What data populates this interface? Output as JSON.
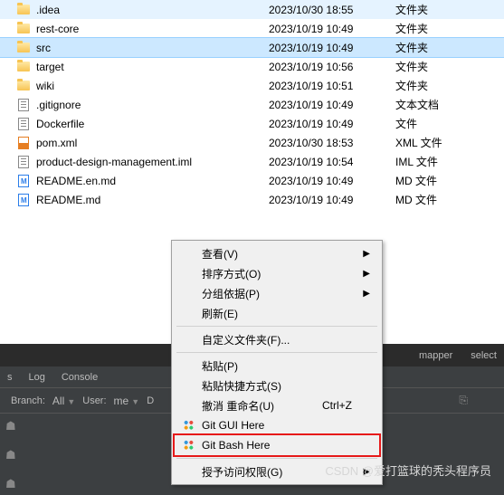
{
  "files": [
    {
      "name": ".idea",
      "date": "2023/10/30 18:55",
      "type": "文件夹",
      "icon": "folder"
    },
    {
      "name": "rest-core",
      "date": "2023/10/19 10:49",
      "type": "文件夹",
      "icon": "folder"
    },
    {
      "name": "src",
      "date": "2023/10/19 10:49",
      "type": "文件夹",
      "icon": "folder",
      "selected": true
    },
    {
      "name": "target",
      "date": "2023/10/19 10:56",
      "type": "文件夹",
      "icon": "folder"
    },
    {
      "name": "wiki",
      "date": "2023/10/19 10:51",
      "type": "文件夹",
      "icon": "folder"
    },
    {
      "name": ".gitignore",
      "date": "2023/10/19 10:49",
      "type": "文本文档",
      "icon": "doc"
    },
    {
      "name": "Dockerfile",
      "date": "2023/10/19 10:49",
      "type": "文件",
      "icon": "doc"
    },
    {
      "name": "pom.xml",
      "date": "2023/10/30 18:53",
      "type": "XML 文件",
      "icon": "orange"
    },
    {
      "name": "product-design-management.iml",
      "date": "2023/10/19 10:54",
      "type": "IML 文件",
      "icon": "doc"
    },
    {
      "name": "README.en.md",
      "date": "2023/10/19 10:49",
      "type": "MD 文件",
      "icon": "md"
    },
    {
      "name": "README.md",
      "date": "2023/10/19 10:49",
      "type": "MD 文件",
      "icon": "md"
    }
  ],
  "darkPanel": {
    "topRight1": "mapper",
    "topRight2": "select",
    "tabs": [
      "s",
      "Log",
      "Console"
    ],
    "branchLabel": "Branch:",
    "branchValue": "All",
    "userLabel": "User:",
    "userValue": "me",
    "dateLabel": "D"
  },
  "menu": {
    "view": "查看(V)",
    "sort": "排序方式(O)",
    "group": "分组依据(P)",
    "refresh": "刷新(E)",
    "customize": "自定义文件夹(F)...",
    "paste": "粘贴(P)",
    "pasteShortcut": "粘贴快捷方式(S)",
    "undo": "撤消 重命名(U)",
    "undoKey": "Ctrl+Z",
    "gitGui": "Git GUI Here",
    "gitBash": "Git Bash Here",
    "access": "授予访问权限(G)"
  },
  "watermark": "CSDN @爱打篮球的秃头程序员"
}
